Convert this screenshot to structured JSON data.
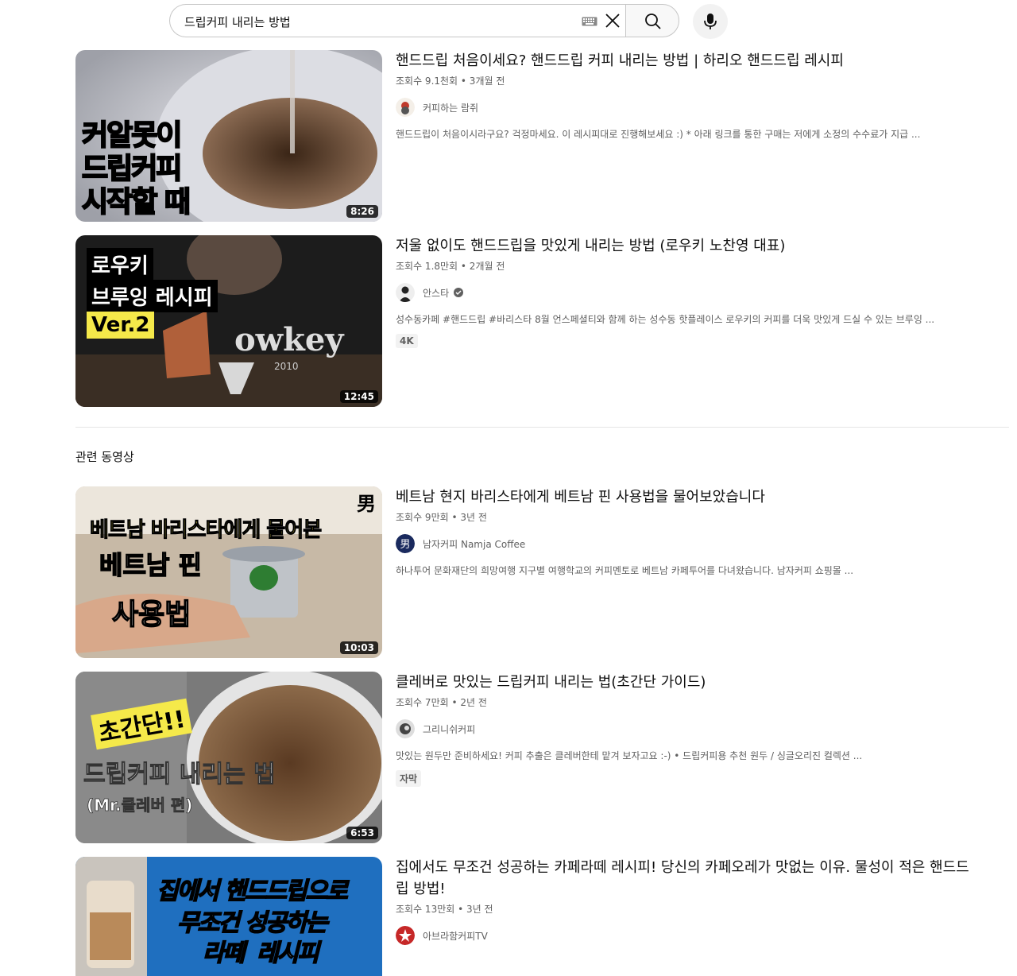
{
  "search": {
    "query": "드립커피 내리는 방법"
  },
  "section": {
    "related_title": "관련 동영상"
  },
  "videos": [
    {
      "title": "핸드드립 처음이세요? 핸드드립 커피 내리는 방법 | 하리오 핸드드립 레시피",
      "meta": "조회수 9.1천회 • 3개월 전",
      "channel": "커피하는 람쥐",
      "desc": "핸드드립이 처음이시라구요? 걱정마세요. 이 레시피대로 진행해보세요 :) * 아래 링크를 통한 구매는 저에게 소정의 수수료가 지급 ...",
      "duration": "8:26",
      "thumb_text": [
        "커알못이",
        "드립커피",
        "시작할 때"
      ]
    },
    {
      "title": "저울 없이도 핸드드립을 맛있게 내리는 방법 (로우키 노찬영 대표)",
      "meta": "조회수 1.8만회 • 2개월 전",
      "channel": "안스타",
      "desc": "성수동카페 #핸드드립 #바리스타 8월 언스페셜티와 함께 하는 성수동 핫플레이스 로우키의 커피를 더욱 맛있게 드실 수 있는 브루잉 ...",
      "badge": "4K",
      "duration": "12:45",
      "thumb_text": [
        "로우키",
        "브루잉 레시피",
        "Ver.2",
        "owkey",
        "2010"
      ]
    },
    {
      "title": "베트남 현지 바리스타에게 베트남 핀 사용법을 물어보았습니다",
      "meta": "조회수 9만회 • 3년 전",
      "channel": "남자커피 Namja Coffee",
      "desc": "하나투어 문화재단의 희망여행 지구별 여행학교의 커피멘토로 베트남 카페투어를 다녀왔습니다. 남자커피 쇼핑몰 ...",
      "duration": "10:03",
      "thumb_text": [
        "베트남 바리스타에게 물어본",
        "베트남 핀",
        "사용법",
        "男"
      ]
    },
    {
      "title": "클레버로 맛있는 드립커피 내리는 법(초간단 가이드)",
      "meta": "조회수 7만회 • 2년 전",
      "channel": "그리니쉬커피",
      "desc": "맛있는 원두만 준비하세요! 커피 추출은 클레버한테 맡겨 보자고요 :-) • 드립커피용 추천 원두 / 싱글오리진 컬렉션 ...",
      "badge": "자막",
      "duration": "6:53",
      "thumb_text": [
        "초간단!!",
        "드립커피 내리는 법",
        "(Mr.클레버 편)"
      ]
    },
    {
      "title": "집에서도 무조건 성공하는 카페라떼 레시피! 당신의 카페오레가 맛없는 이유. 물성이 적은 핸드드립 방법!",
      "meta": "조회수 13만회 • 3년 전",
      "channel": "아브라함커피TV",
      "thumb_text": [
        "집에서 핸드드립으로",
        "무조건 성공하는",
        "라떼",
        "레시피"
      ]
    }
  ],
  "colors": {
    "yellow": "#f5e94a",
    "blue_banner": "#1f6fbf"
  }
}
